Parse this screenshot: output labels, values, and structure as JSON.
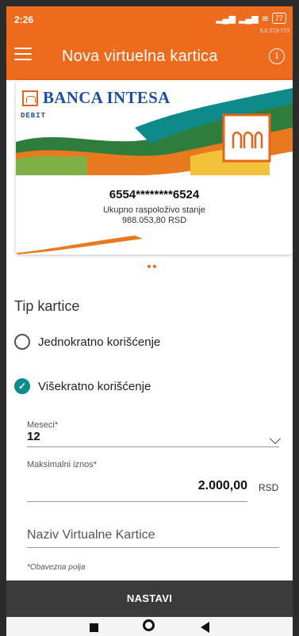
{
  "status": {
    "time": "2:26",
    "battery": "77",
    "version": "5.0.273-773"
  },
  "app_bar": {
    "title": "Nova virtuelna kartica",
    "menu_icon": "hamburger-menu-icon",
    "info_icon": "info-icon"
  },
  "card": {
    "bank_name": "BANCA INTESA",
    "type": "DEBIT",
    "number": "6554********6524",
    "balance_label": "Ukupno raspoloživo stanje",
    "balance_value": "988.053,80 RSD"
  },
  "form": {
    "section_title": "Tip kartice",
    "options": [
      {
        "label": "Jednokratno korišćenje",
        "selected": false
      },
      {
        "label": "Višekratno korišćenje",
        "selected": true
      }
    ],
    "months_label": "Meseci*",
    "months_value": "12",
    "max_amount_label": "Maksimalni iznos*",
    "max_amount_value": "2.000,00",
    "currency": "RSD",
    "card_name_placeholder": "Naziv Virtualne Kartice",
    "required_note": "*Obavezna polja"
  },
  "actions": {
    "next_label": "NASTAVI"
  },
  "colors": {
    "accent": "#ee6a1c",
    "check": "#0f8a8a",
    "bank_blue": "#1c4ea3"
  }
}
